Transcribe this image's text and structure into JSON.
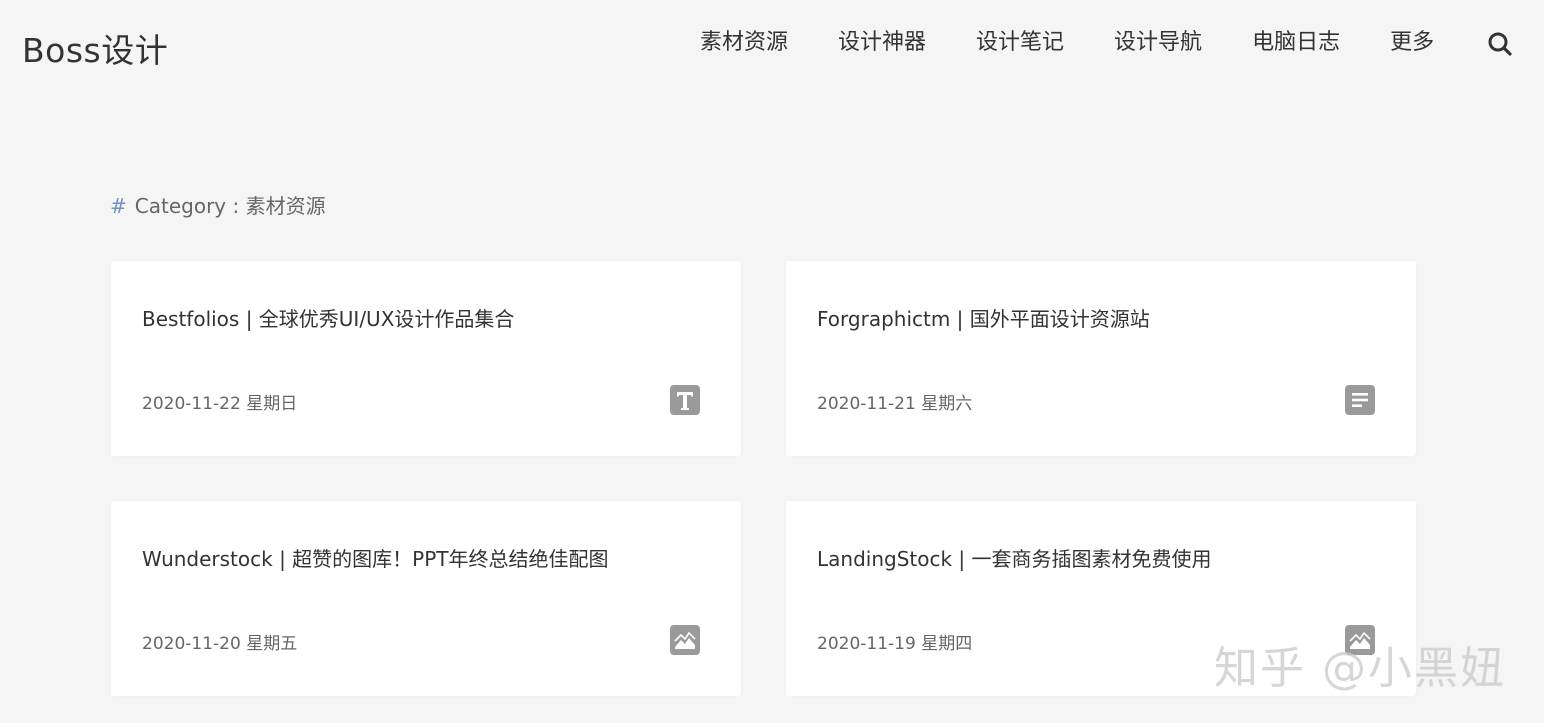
{
  "header": {
    "site_title": "Boss设计",
    "nav": [
      "素材资源",
      "设计神器",
      "设计笔记",
      "设计导航",
      "电脑日志",
      "更多"
    ],
    "search_icon": "search-icon"
  },
  "category": {
    "hash": "#",
    "label": "Category : 素材资源"
  },
  "posts": [
    {
      "title": "Bestfolios | 全球优秀UI/UX设计作品集合",
      "date": "2020-11-22 星期日",
      "icon": "text-format-icon"
    },
    {
      "title": "Forgraphictm | 国外平面设计资源站",
      "date": "2020-11-21 星期六",
      "icon": "article-icon"
    },
    {
      "title": "Wunderstock | 超赞的图库！PPT年终总结绝佳配图",
      "date": "2020-11-20 星期五",
      "icon": "image-icon"
    },
    {
      "title": "LandingStock | 一套商务插图素材免费使用",
      "date": "2020-11-19 星期四",
      "icon": "image-icon"
    }
  ],
  "watermark": "知乎 @小黑妞",
  "colors": {
    "background": "#f5f5f5",
    "card": "#ffffff",
    "icon": "#999999",
    "hash_accent": "#6d94c4"
  }
}
